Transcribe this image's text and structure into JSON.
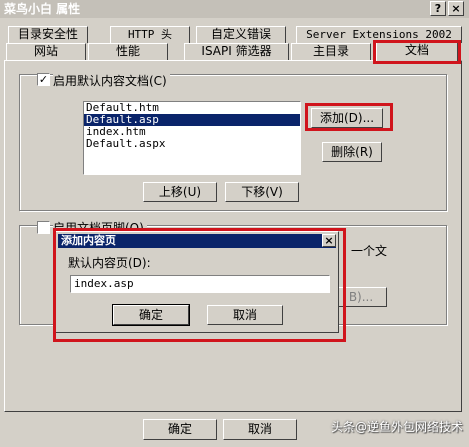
{
  "window": {
    "title": "菜鸟小白 属性",
    "help_btn": "?",
    "close_btn": "×"
  },
  "tabs_row1": [
    {
      "label": "目录安全性"
    },
    {
      "label": "HTTP 头"
    },
    {
      "label": "自定义错误"
    },
    {
      "label": "Server Extensions 2002"
    }
  ],
  "tabs_row2": [
    {
      "label": "网站"
    },
    {
      "label": "性能"
    },
    {
      "label": "ISAPI 筛选器"
    },
    {
      "label": "主目录"
    },
    {
      "label": "文档"
    }
  ],
  "doc_panel": {
    "enable_default_label": "启用默认内容文档(C)",
    "enable_default_checked": "✓",
    "default_docs": [
      "Default.htm",
      "Default.asp",
      "index.htm",
      "Default.aspx"
    ],
    "selected_index": 1,
    "add_button": "添加(D)...",
    "remove_button": "删除(R)",
    "move_up_button": "上移(U)",
    "move_down_button": "下移(V)",
    "enable_footer_label": "启用文档页脚(O)",
    "footer_partial_text": "一个文",
    "browse_partial": "B)..."
  },
  "dialog": {
    "title": "添加内容页",
    "field_label": "默认内容页(D):",
    "field_value": "index.asp",
    "ok_button": "确定",
    "cancel_button": "取消",
    "close_btn": "×"
  },
  "footer_buttons": {
    "ok": "确定",
    "cancel": "取消"
  },
  "watermark": "头条@逆鱼外包网络技术"
}
